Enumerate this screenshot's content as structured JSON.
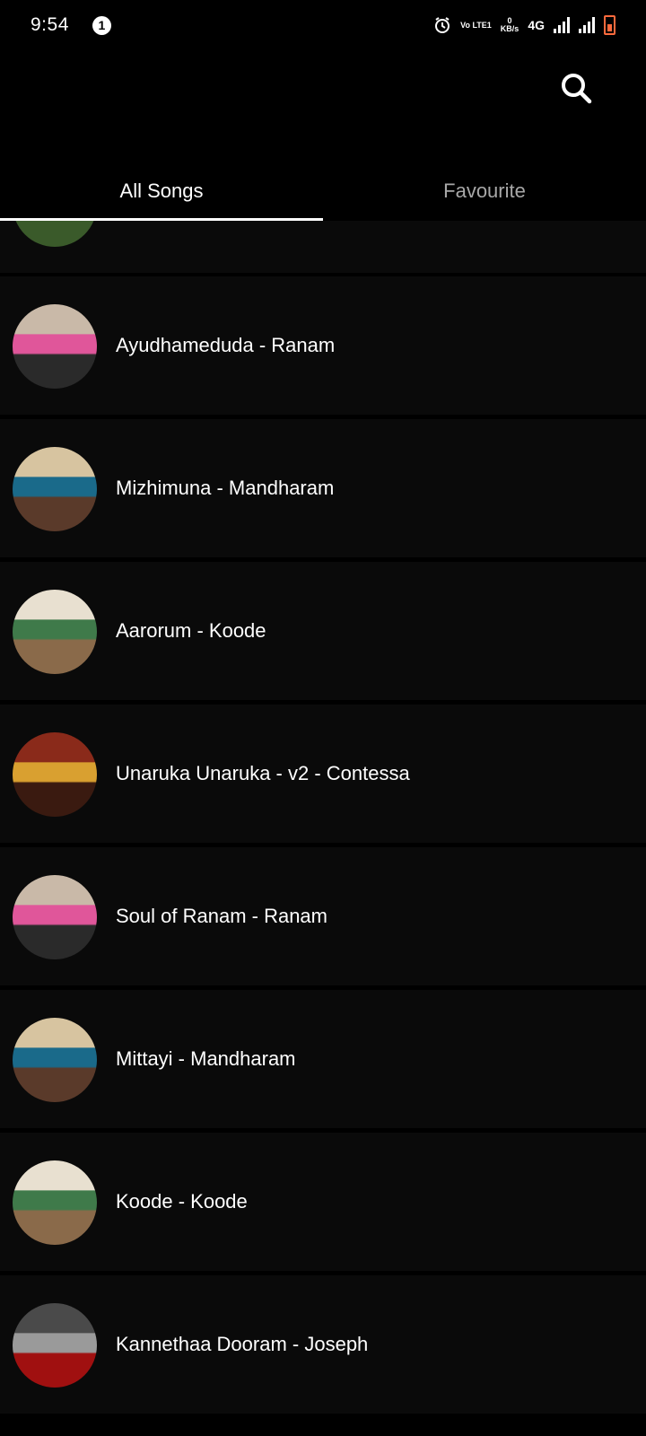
{
  "status_bar": {
    "time": "9:54",
    "notification_count": "1",
    "volte_label": "Vo LTE1",
    "speed_value": "0",
    "speed_unit": "KB/s",
    "network": "4G",
    "battery_color": "#ff6a3d"
  },
  "app_bar": {
    "search_icon": "search-icon"
  },
  "tabs": [
    {
      "label": "All Songs",
      "active": true
    },
    {
      "label": "Favourite",
      "active": false
    }
  ],
  "songs": [
    {
      "title": "",
      "art": "partial-cover",
      "colors": [
        "#6a7a4a",
        "#d9c9a0",
        "#3a5a2a"
      ]
    },
    {
      "title": "Ayudhameduda - Ranam",
      "art": "ranam-cover",
      "colors": [
        "#c9b9a8",
        "#e0569a",
        "#2a2a2a"
      ]
    },
    {
      "title": "Mizhimuna - Mandharam",
      "art": "mandharam-cover",
      "colors": [
        "#d7c4a0",
        "#1a6a8a",
        "#5a3a2a"
      ]
    },
    {
      "title": "Aarorum - Koode",
      "art": "koode-cover",
      "colors": [
        "#e8e0d0",
        "#3f7a4a",
        "#8a6a4a"
      ]
    },
    {
      "title": "Unaruka Unaruka - v2 - Contessa",
      "art": "contessa-cover",
      "colors": [
        "#8a2a1a",
        "#d9a030",
        "#3a1a10"
      ]
    },
    {
      "title": "Soul of Ranam - Ranam",
      "art": "ranam-cover",
      "colors": [
        "#c9b9a8",
        "#e0569a",
        "#2a2a2a"
      ]
    },
    {
      "title": "Mittayi - Mandharam",
      "art": "mandharam-cover",
      "colors": [
        "#d7c4a0",
        "#1a6a8a",
        "#5a3a2a"
      ]
    },
    {
      "title": "Koode - Koode",
      "art": "koode-cover",
      "colors": [
        "#e8e0d0",
        "#3f7a4a",
        "#8a6a4a"
      ]
    },
    {
      "title": "Kannethaa Dooram - Joseph",
      "art": "joseph-cover",
      "colors": [
        "#4a4a4a",
        "#9a9a9a",
        "#a01010"
      ]
    }
  ]
}
